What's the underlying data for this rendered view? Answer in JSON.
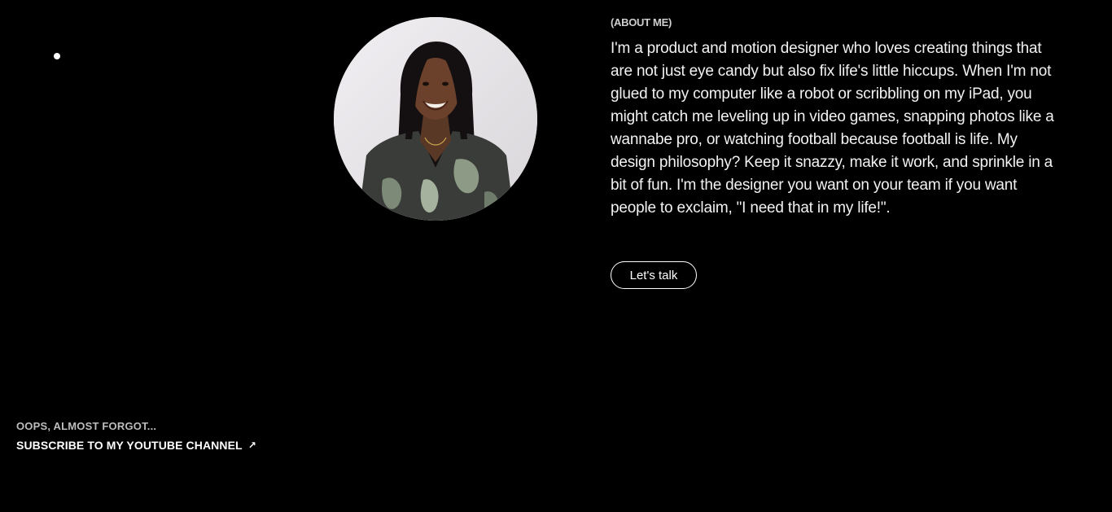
{
  "about": {
    "label": "(ABOUT ME)",
    "text": "I'm a product and motion designer who loves creating things that are not just eye candy but also fix life's little hiccups. When I'm not glued to my computer like a robot or scribbling on my iPad, you might catch me leveling up in video games, snapping photos like a wannabe pro, or watching football because football is life. My design philosophy? Keep it snazzy, make it work, and sprinkle in a bit of fun. I'm the designer you want on your team if you want people to exclaim, \"I need that in my life!\".",
    "cta_label": "Let's talk"
  },
  "footer": {
    "note": "OOPS, ALMOST FORGOT...",
    "link_label": "SUBSCRIBE TO MY YOUTUBE CHANNEL",
    "link_icon": "arrow-up-right-icon",
    "link_glyph": "↗"
  },
  "colors": {
    "background": "#000000",
    "text": "#ffffff",
    "muted_text": "#bdbdbd"
  }
}
